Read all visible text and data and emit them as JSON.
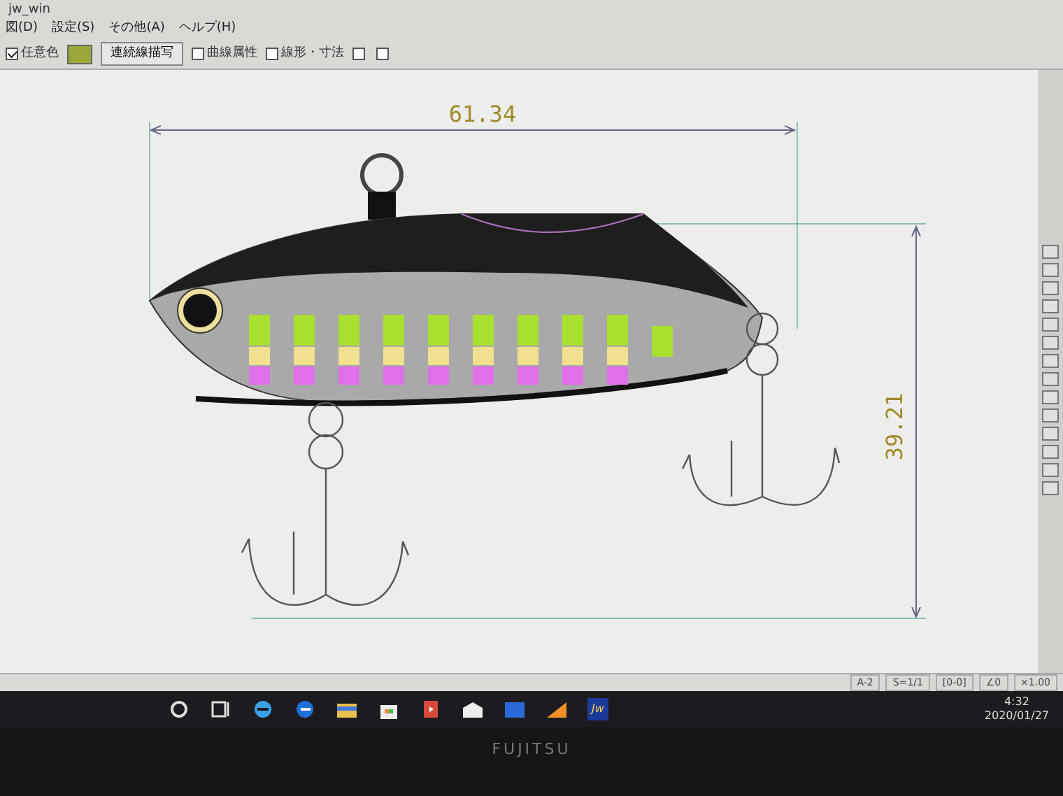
{
  "window": {
    "title": "jw_win"
  },
  "menu": [
    "図(D)",
    "設定(S)",
    "その他(A)",
    "ヘルプ(H)"
  ],
  "toolbar": [
    {
      "kind": "checkbox",
      "label": "任意色",
      "checked": true
    },
    {
      "kind": "swatch",
      "color": "#9aa83a"
    },
    {
      "kind": "button",
      "label": "連続線描写"
    },
    {
      "kind": "checkbox",
      "label": "曲線属性",
      "checked": false
    },
    {
      "kind": "checkbox",
      "label": "線形・寸法",
      "checked": false
    },
    {
      "kind": "checkbox",
      "checked": false
    },
    {
      "kind": "checkbox",
      "checked": false
    }
  ],
  "drawing": {
    "width_dimension": "61.34",
    "height_dimension": "39.21"
  },
  "status_bar": {
    "fields": [
      "A-2",
      "S=1/1",
      "[0-0]",
      "∠0",
      "×1.00"
    ]
  },
  "taskbar": {
    "app_label": "Jw",
    "time": "4:32",
    "date": "2020/01/27"
  },
  "bezel_brand": "FUJITSU"
}
